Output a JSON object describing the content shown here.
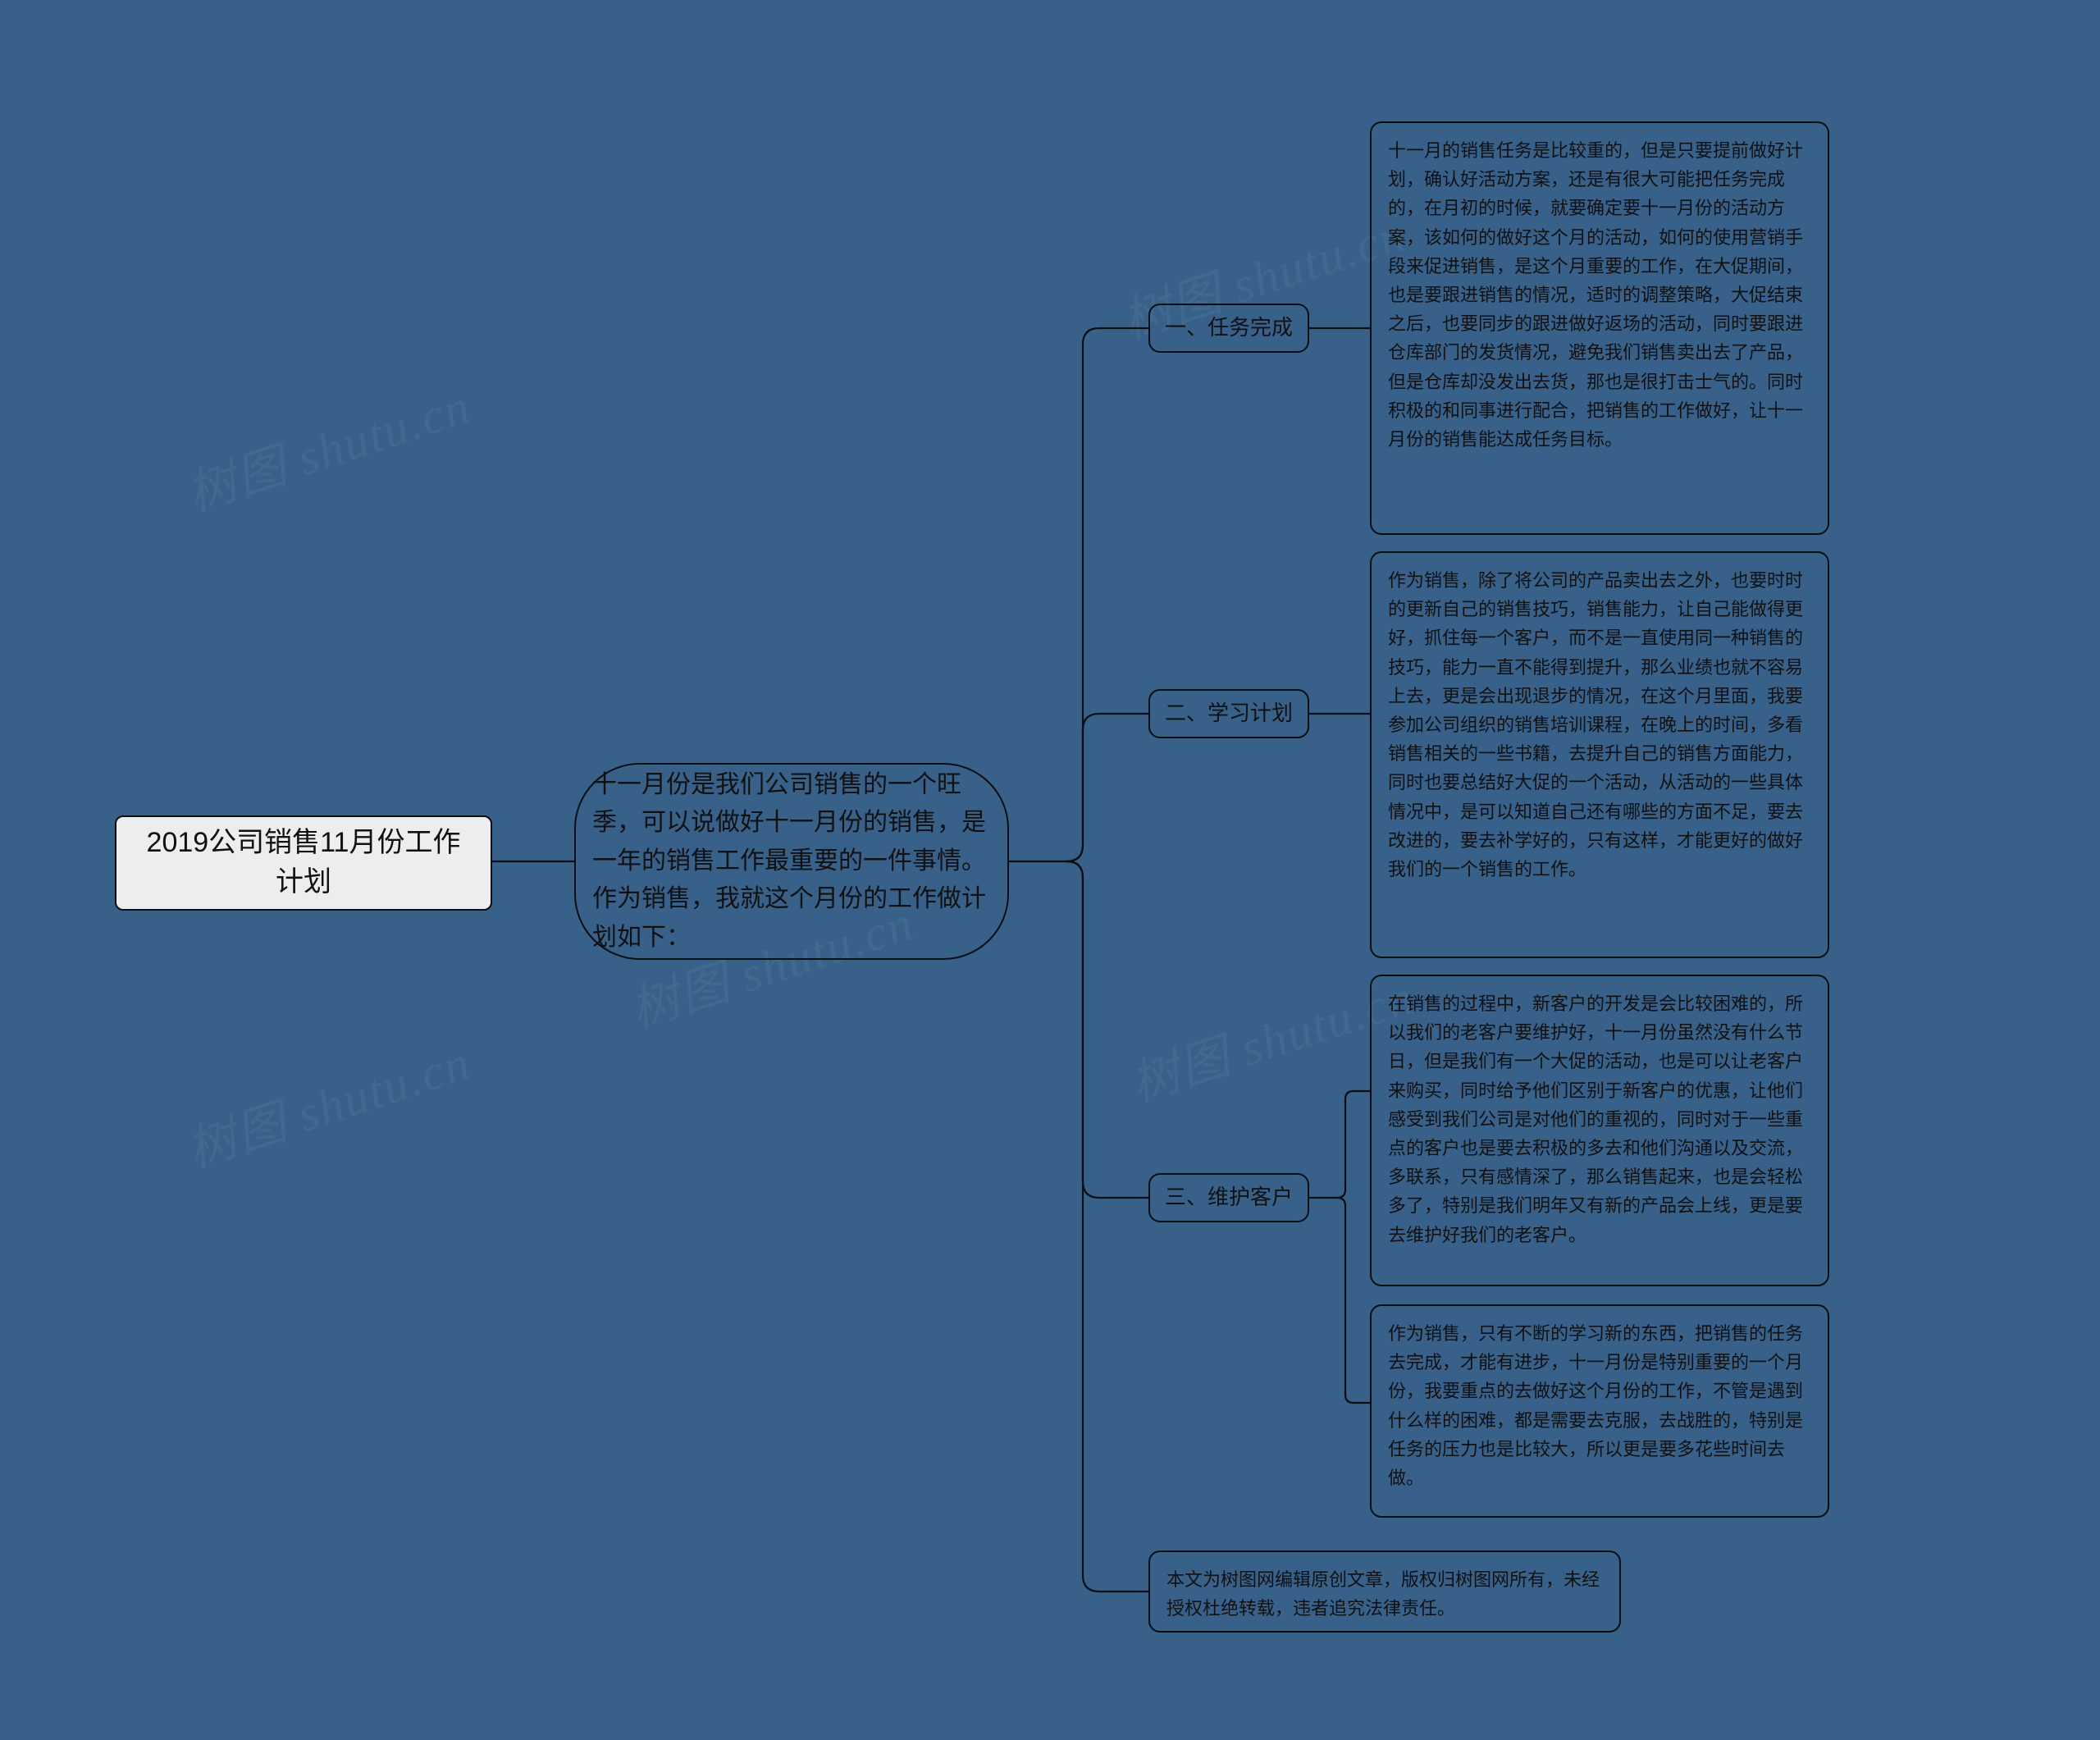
{
  "watermark_text": "树图 shutu.cn",
  "root": {
    "title": "2019公司销售11月份工作计划"
  },
  "intro": {
    "text": "十一月份是我们公司销售的一个旺季，可以说做好十一月份的销售，是一年的销售工作最重要的一件事情。作为销售，我就这个月份的工作做计划如下："
  },
  "branches": [
    {
      "label": "一、任务完成",
      "leaves": [
        "十一月的销售任务是比较重的，但是只要提前做好计划，确认好活动方案，还是有很大可能把任务完成的，在月初的时候，就要确定要十一月份的活动方案，该如何的做好这个月的活动，如何的使用营销手段来促进销售，是这个月重要的工作，在大促期间，也是要跟进销售的情况，适时的调整策略，大促结束之后，也要同步的跟进做好返场的活动，同时要跟进仓库部门的发货情况，避免我们销售卖出去了产品，但是仓库却没发出去货，那也是很打击士气的。同时积极的和同事进行配合，把销售的工作做好，让十一月份的销售能达成任务目标。"
      ]
    },
    {
      "label": "二、学习计划",
      "leaves": [
        "作为销售，除了将公司的产品卖出去之外，也要时时的更新自己的销售技巧，销售能力，让自己能做得更好，抓住每一个客户，而不是一直使用同一种销售的技巧，能力一直不能得到提升，那么业绩也就不容易上去，更是会出现退步的情况，在这个月里面，我要参加公司组织的销售培训课程，在晚上的时间，多看销售相关的一些书籍，去提升自己的销售方面能力，同时也要总结好大促的一个活动，从活动的一些具体情况中，是可以知道自己还有哪些的方面不足，要去改进的，要去补学好的，只有这样，才能更好的做好我们的一个销售的工作。"
      ]
    },
    {
      "label": "三、维护客户",
      "leaves": [
        "在销售的过程中，新客户的开发是会比较困难的，所以我们的老客户要维护好，十一月份虽然没有什么节日，但是我们有一个大促的活动，也是可以让老客户来购买，同时给予他们区别于新客户的优惠，让他们感受到我们公司是对他们的重视的，同时对于一些重点的客户也是要去积极的多去和他们沟通以及交流，多联系，只有感情深了，那么销售起来，也是会轻松多了，特别是我们明年又有新的产品会上线，更是要去维护好我们的老客户。",
        "作为销售，只有不断的学习新的东西，把销售的任务去完成，才能有进步，十一月份是特别重要的一个月份，我要重点的去做好这个月份的工作，不管是遇到什么样的困难，都是需要去克服，去战胜的，特别是任务的压力也是比较大，所以更是要多花些时间去做。"
      ]
    },
    {
      "label": "本文为树图网编辑原创文章，版权归树图网所有，未经授权杜绝转载，违者追究法律责任。",
      "leaves": []
    }
  ]
}
